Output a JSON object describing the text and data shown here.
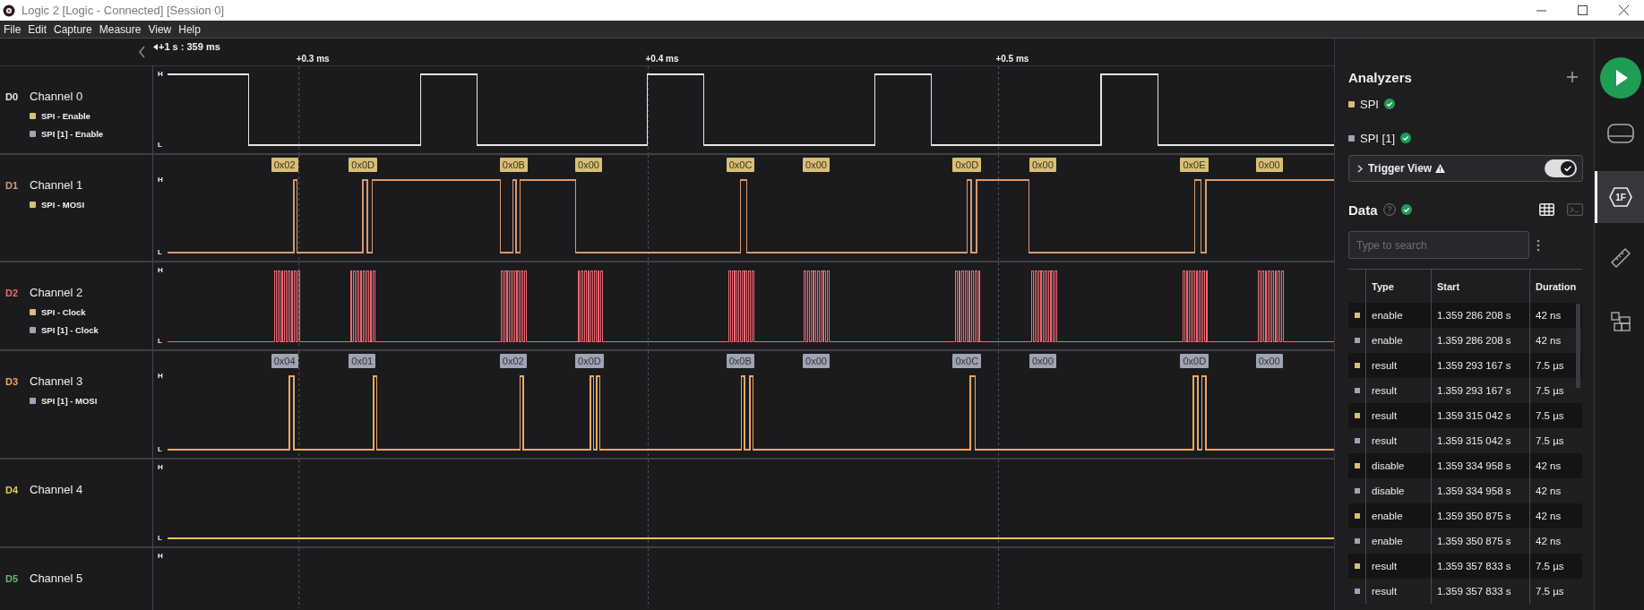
{
  "window": {
    "title": "Logic 2 [Logic - Connected] [Session 0]"
  },
  "menu": [
    "File",
    "Edit",
    "Capture",
    "Measure",
    "View",
    "Help"
  ],
  "timeline": {
    "origin": "+1 s : 359 ms",
    "markers": [
      "+0.3 ms",
      "+0.4 ms",
      "+0.5 ms"
    ]
  },
  "channels": [
    {
      "id": "D0",
      "name": "Channel 0",
      "color": "#e6e6e6",
      "high": "H",
      "low": "L",
      "analyzers": [
        {
          "label": "SPI - Enable",
          "color": "#d9bf73"
        },
        {
          "label": "SPI [1] - Enable",
          "color": "#9ea3b5"
        }
      ]
    },
    {
      "id": "D1",
      "name": "Channel 1",
      "color": "#d39b72",
      "high": "H",
      "low": "L",
      "analyzers": [
        {
          "label": "SPI - MOSI",
          "color": "#d9bf73"
        }
      ],
      "decoded": {
        "color": "#d9bf73",
        "values": [
          "0x02",
          "0x0D",
          "0x0B",
          "0x00",
          "0x0C",
          "0x00",
          "0x0D",
          "0x00",
          "0x0E",
          "0x00"
        ]
      }
    },
    {
      "id": "D2",
      "name": "Channel 2",
      "color": "#ee6b75",
      "high": "H",
      "low": "L",
      "analyzers": [
        {
          "label": "SPI - Clock",
          "color": "#d9bf73"
        },
        {
          "label": "SPI [1] - Clock",
          "color": "#9ea3b5"
        }
      ]
    },
    {
      "id": "D3",
      "name": "Channel 3",
      "color": "#e8a964",
      "high": "H",
      "low": "L",
      "analyzers": [
        {
          "label": "SPI [1] - MOSI",
          "color": "#9ea3b5"
        }
      ],
      "decoded": {
        "color": "#9ea3b5",
        "values": [
          "0x04",
          "0x01",
          "0x02",
          "0x0D",
          "0x0B",
          "0x00",
          "0x0C",
          "0x00",
          "0x0D",
          "0x00"
        ]
      }
    },
    {
      "id": "D4",
      "name": "Channel 4",
      "color": "#e0cc4c",
      "high": "H",
      "low": "L"
    },
    {
      "id": "D5",
      "name": "Channel 5",
      "color": "#5fbf5f",
      "high": "H"
    }
  ],
  "analyzers_panel": {
    "title": "Analyzers",
    "items": [
      {
        "name": "SPI",
        "color": "#d9bf73",
        "valid": true
      },
      {
        "name": "SPI [1]",
        "color": "#9ea3b5",
        "valid": true
      }
    ],
    "trigger_view": {
      "label": "Trigger View",
      "warning": true,
      "on": true
    }
  },
  "data_panel": {
    "title": "Data",
    "valid": true,
    "search": {
      "placeholder": "Type to search"
    },
    "columns": [
      "Type",
      "Start",
      "Duration"
    ],
    "rows": [
      {
        "color": "#d9bf73",
        "type": "enable",
        "start": "1.359 286 208 s",
        "duration": "42 ns"
      },
      {
        "color": "#9ea3b5",
        "type": "enable",
        "start": "1.359 286 208 s",
        "duration": "42 ns"
      },
      {
        "color": "#d9bf73",
        "type": "result",
        "start": "1.359 293 167 s",
        "duration": "7.5 µs"
      },
      {
        "color": "#9ea3b5",
        "type": "result",
        "start": "1.359 293 167 s",
        "duration": "7.5 µs"
      },
      {
        "color": "#d9bf73",
        "type": "result",
        "start": "1.359 315 042 s",
        "duration": "7.5 µs"
      },
      {
        "color": "#9ea3b5",
        "type": "result",
        "start": "1.359 315 042 s",
        "duration": "7.5 µs"
      },
      {
        "color": "#d9bf73",
        "type": "disable",
        "start": "1.359 334 958 s",
        "duration": "42 ns"
      },
      {
        "color": "#9ea3b5",
        "type": "disable",
        "start": "1.359 334 958 s",
        "duration": "42 ns"
      },
      {
        "color": "#d9bf73",
        "type": "enable",
        "start": "1.359 350 875 s",
        "duration": "42 ns"
      },
      {
        "color": "#9ea3b5",
        "type": "enable",
        "start": "1.359 350 875 s",
        "duration": "42 ns"
      },
      {
        "color": "#d9bf73",
        "type": "result",
        "start": "1.359 357 833 s",
        "duration": "7.5 µs"
      },
      {
        "color": "#9ea3b5",
        "type": "result",
        "start": "1.359 357 833 s",
        "duration": "7.5 µs"
      }
    ]
  },
  "side_tabs": [
    {
      "kind": "record",
      "selected": false
    },
    {
      "kind": "device",
      "selected": false
    },
    {
      "kind": "analyzers",
      "label": "1F",
      "selected": true
    },
    {
      "kind": "measure",
      "selected": false
    },
    {
      "kind": "extensions",
      "selected": false
    }
  ]
}
